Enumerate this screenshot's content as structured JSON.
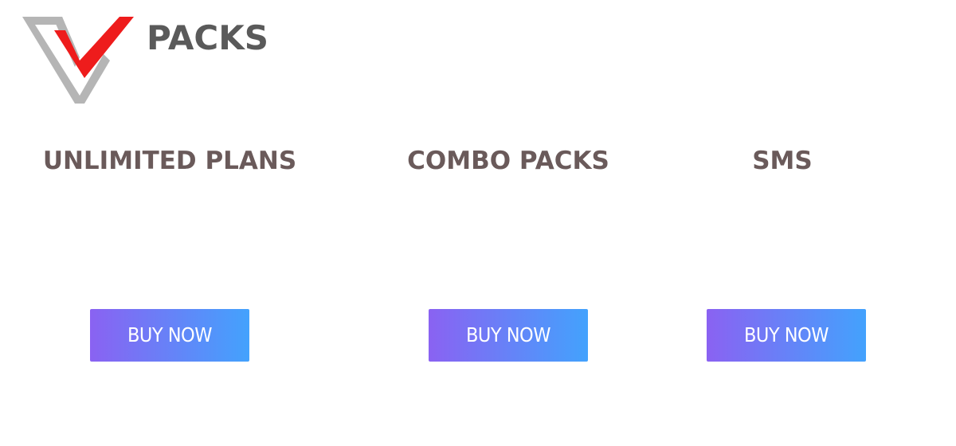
{
  "brand": {
    "name": "PACKS",
    "logo_icon": "v-logo-icon",
    "colors": {
      "logo_gray": "#b5b5b5",
      "logo_red": "#ee1c1c",
      "text_dark": "#5a5a5a",
      "title_color": "#6a5a5a"
    }
  },
  "plans": [
    {
      "title": "UNLIMITED PLANS",
      "button_label": "BUY NOW"
    },
    {
      "title": "COMBO PACKS",
      "button_label": "BUY NOW"
    },
    {
      "title": "SMS",
      "button_label": "BUY NOW"
    }
  ],
  "button_gradient": {
    "from": "#8a62f2",
    "to": "#43a2fd"
  }
}
